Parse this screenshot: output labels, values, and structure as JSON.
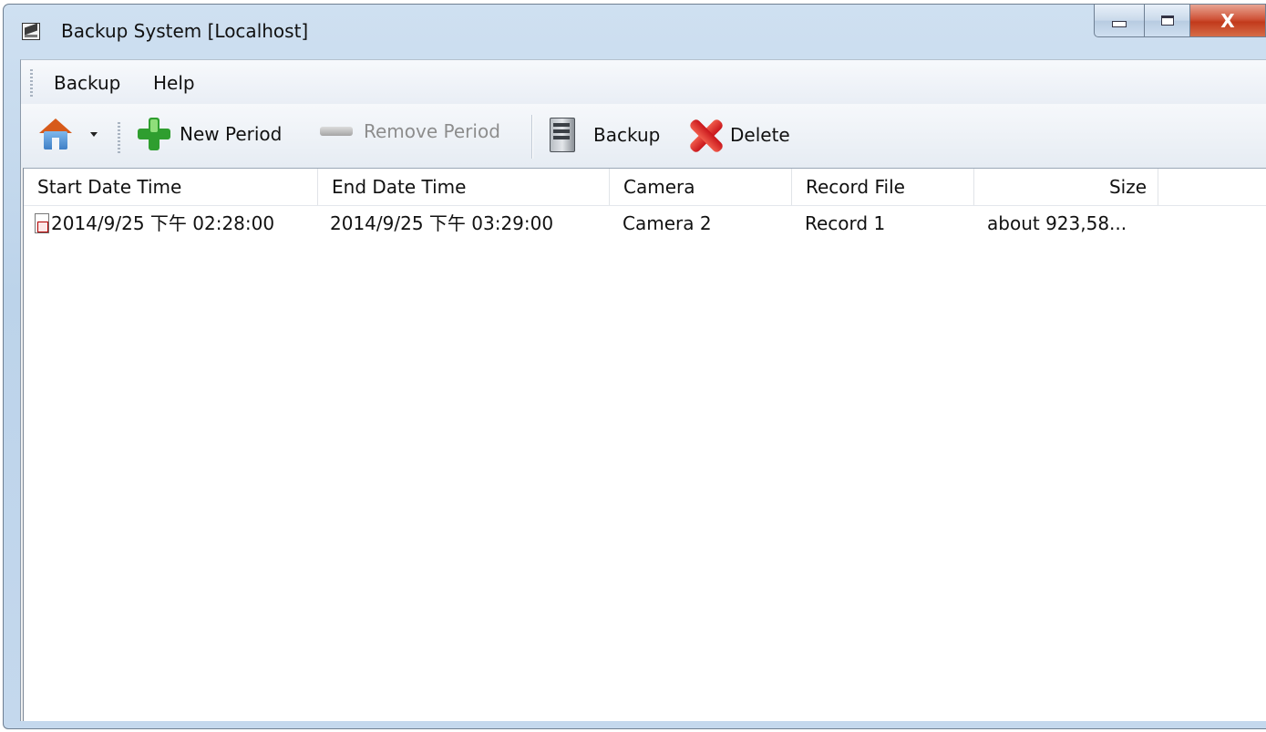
{
  "window": {
    "title": "Backup System [Localhost]",
    "close_glyph": "X"
  },
  "menu": {
    "items": [
      "Backup",
      "Help"
    ]
  },
  "toolbar": {
    "new_period_label": "New Period",
    "remove_period_label": "Remove Period",
    "backup_label": "Backup",
    "delete_label": "Delete"
  },
  "table": {
    "columns": [
      "Start Date Time",
      "End Date Time",
      "Camera",
      "Record File",
      "Size"
    ],
    "rows": [
      {
        "start": "2014/9/25 下午 02:28:00",
        "end": "2014/9/25 下午 03:29:00",
        "camera": "Camera 2",
        "record_file": "Record 1",
        "size": "about 923,58..."
      }
    ]
  },
  "icons": {
    "app": "video-camera-icon",
    "home": "house-icon",
    "new_period": "plus-icon",
    "remove_period": "minus-icon",
    "backup": "server-icon",
    "delete": "red-x-icon",
    "row": "record-file-icon"
  },
  "colors": {
    "plus_green": "#2f9e2f",
    "delete_red": "#d3241d",
    "close_red": "#c8432a",
    "disabled_text": "#8d8d8d"
  }
}
